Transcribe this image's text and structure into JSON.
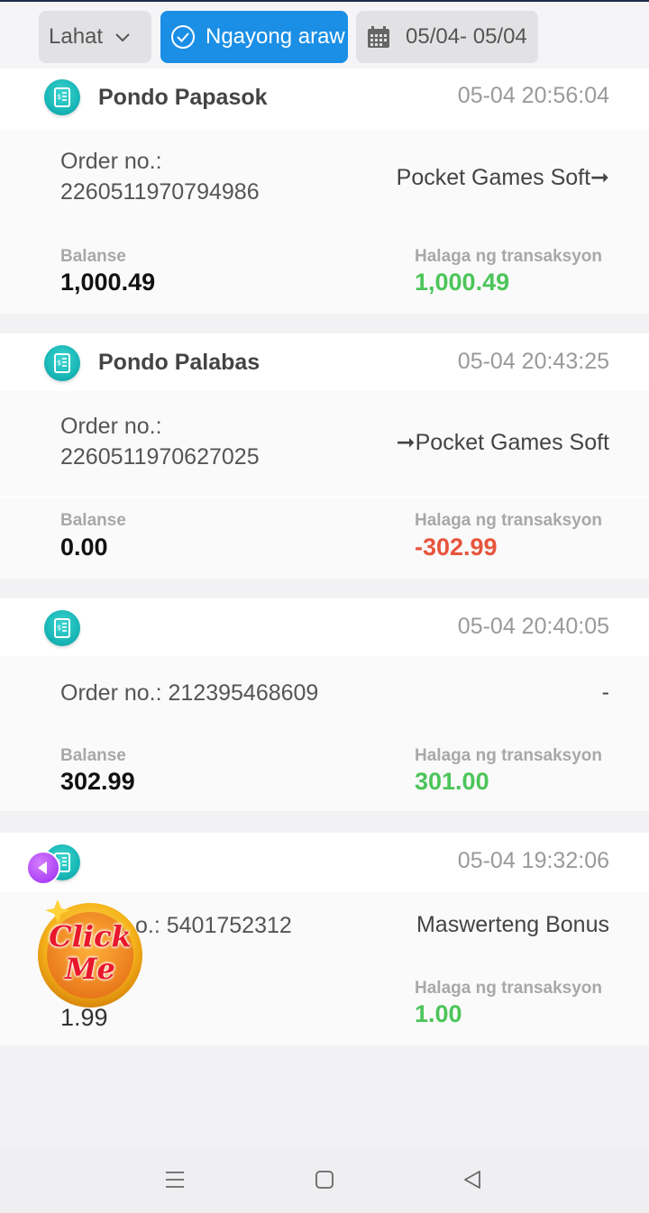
{
  "filters": {
    "type_label": "Lahat",
    "today_label": "Ngayong araw",
    "date_range": "05/04- 05/04"
  },
  "records": [
    {
      "title": "Pondo Papasok",
      "time": "05-04 20:56:04",
      "order_label": "Order no.:",
      "order_no": "2260511970794986",
      "destination": "Pocket Games Soft➞",
      "balance_label": "Balanse",
      "balance": "1,000.49",
      "amount_label": "Halaga ng transaksyon",
      "amount": "1,000.49"
    },
    {
      "title": "Pondo Palabas",
      "time": "05-04 20:43:25",
      "order_label": "Order no.:",
      "order_no": "2260511970627025",
      "destination": "➞Pocket Games Soft",
      "balance_label": "Balanse",
      "balance": "0.00",
      "amount_label": "Halaga ng transaksyon",
      "amount": "-302.99"
    },
    {
      "title": "",
      "time": "05-04 20:40:05",
      "order_line": "Order no.: 212395468609",
      "destination": "-",
      "balance_label": "Balanse",
      "balance": "302.99",
      "amount_label": "Halaga ng transaksyon",
      "amount": "301.00"
    },
    {
      "title": "",
      "time": "05-04 19:32:06",
      "order_partial": "o.: 5401752312",
      "destination": "Maswerteng Bonus",
      "balance_partial": "1.99",
      "amount_label": "Halaga ng transaksyon",
      "amount": "1.00"
    }
  ],
  "promo": {
    "text_top": "Click",
    "text_bottom": "Me"
  },
  "colors": {
    "accent": "#1b8fe6",
    "positive": "#4cc55a",
    "negative": "#e8543c"
  },
  "icons": [
    "chevron-down-icon",
    "check-circle-icon",
    "calendar-icon",
    "receipt-coin-icon",
    "menu-icon",
    "home-icon",
    "back-icon"
  ]
}
